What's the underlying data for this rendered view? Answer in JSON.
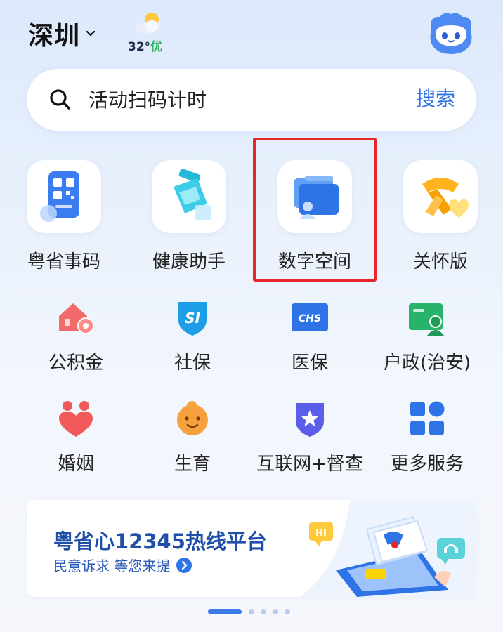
{
  "header": {
    "city": "深圳",
    "weather_temp": "32°",
    "weather_aqi": "优"
  },
  "search": {
    "value": "活动扫码计时",
    "button_label": "搜索"
  },
  "main_services": [
    {
      "label": "粤省事码",
      "icon": "qr-code-card-icon"
    },
    {
      "label": "健康助手",
      "icon": "health-bottle-icon"
    },
    {
      "label": "数字空间",
      "icon": "digital-space-folder-icon"
    },
    {
      "label": "关怀版",
      "icon": "care-scarf-heart-icon"
    }
  ],
  "grid_services": [
    {
      "label": "公积金",
      "icon": "house-fund-icon"
    },
    {
      "label": "社保",
      "icon": "social-security-shield-icon"
    },
    {
      "label": "医保",
      "icon": "chs-medical-insurance-icon"
    },
    {
      "label": "户政(治安)",
      "icon": "household-registration-icon"
    },
    {
      "label": "婚姻",
      "icon": "marriage-heart-icon"
    },
    {
      "label": "生育",
      "icon": "baby-face-icon"
    },
    {
      "label": "互联网+督查",
      "icon": "star-shield-icon"
    },
    {
      "label": "更多服务",
      "icon": "grid-more-icon"
    }
  ],
  "banner": {
    "title": "粤省心12345热线平台",
    "subtitle": "民意诉求 等您来提",
    "bubble_text": "HI"
  },
  "pager": {
    "pages": 5,
    "active": 0
  },
  "colors": {
    "accent": "#2f74e6",
    "highlight": "#e5262a",
    "banner_title": "#1f4fa8"
  }
}
